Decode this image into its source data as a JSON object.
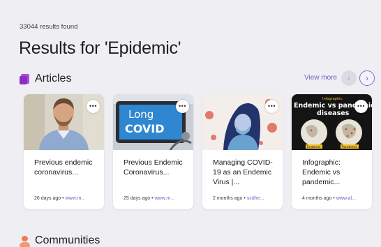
{
  "header": {
    "results_count": "33044 results found",
    "title": "Results for 'Epidemic'"
  },
  "articles": {
    "section_title": "Articles",
    "view_more": "View more",
    "icon": "articles-icon",
    "cards": [
      {
        "title": "Previous endemic coronavirus...",
        "age": "26 days ago",
        "source": "www.m...",
        "image": "portrait-photo"
      },
      {
        "title": "Previous Endemic Coronavirus...",
        "age": "25 days ago",
        "source": "www.m...",
        "image": "long-covid-tablet",
        "image_text_1": "Long",
        "image_text_2": "COVID"
      },
      {
        "title": "Managing COVID-19 as an Endemic Virus |...",
        "age": "2 months ago",
        "source": "scdhe...",
        "image": "woman-mask-illustration"
      },
      {
        "title": "Infographic: Endemic vs pandemic...",
        "age": "4 months ago",
        "source": "www.al...",
        "image": "endemic-vs-pandemic-infographic",
        "image_text_small": "Infographic:",
        "image_text_1": "Endemic vs pandemic",
        "image_text_2": "diseases",
        "image_label_left": "Endemic",
        "image_label_right": "Pandemic"
      }
    ]
  },
  "communities": {
    "section_title": "Communities",
    "icon": "communities-icon"
  },
  "colors": {
    "background": "#efeef2",
    "accent": "#6b5fc8",
    "articles_icon": "#b24bd8",
    "communities_icon": "#f07a5a"
  }
}
